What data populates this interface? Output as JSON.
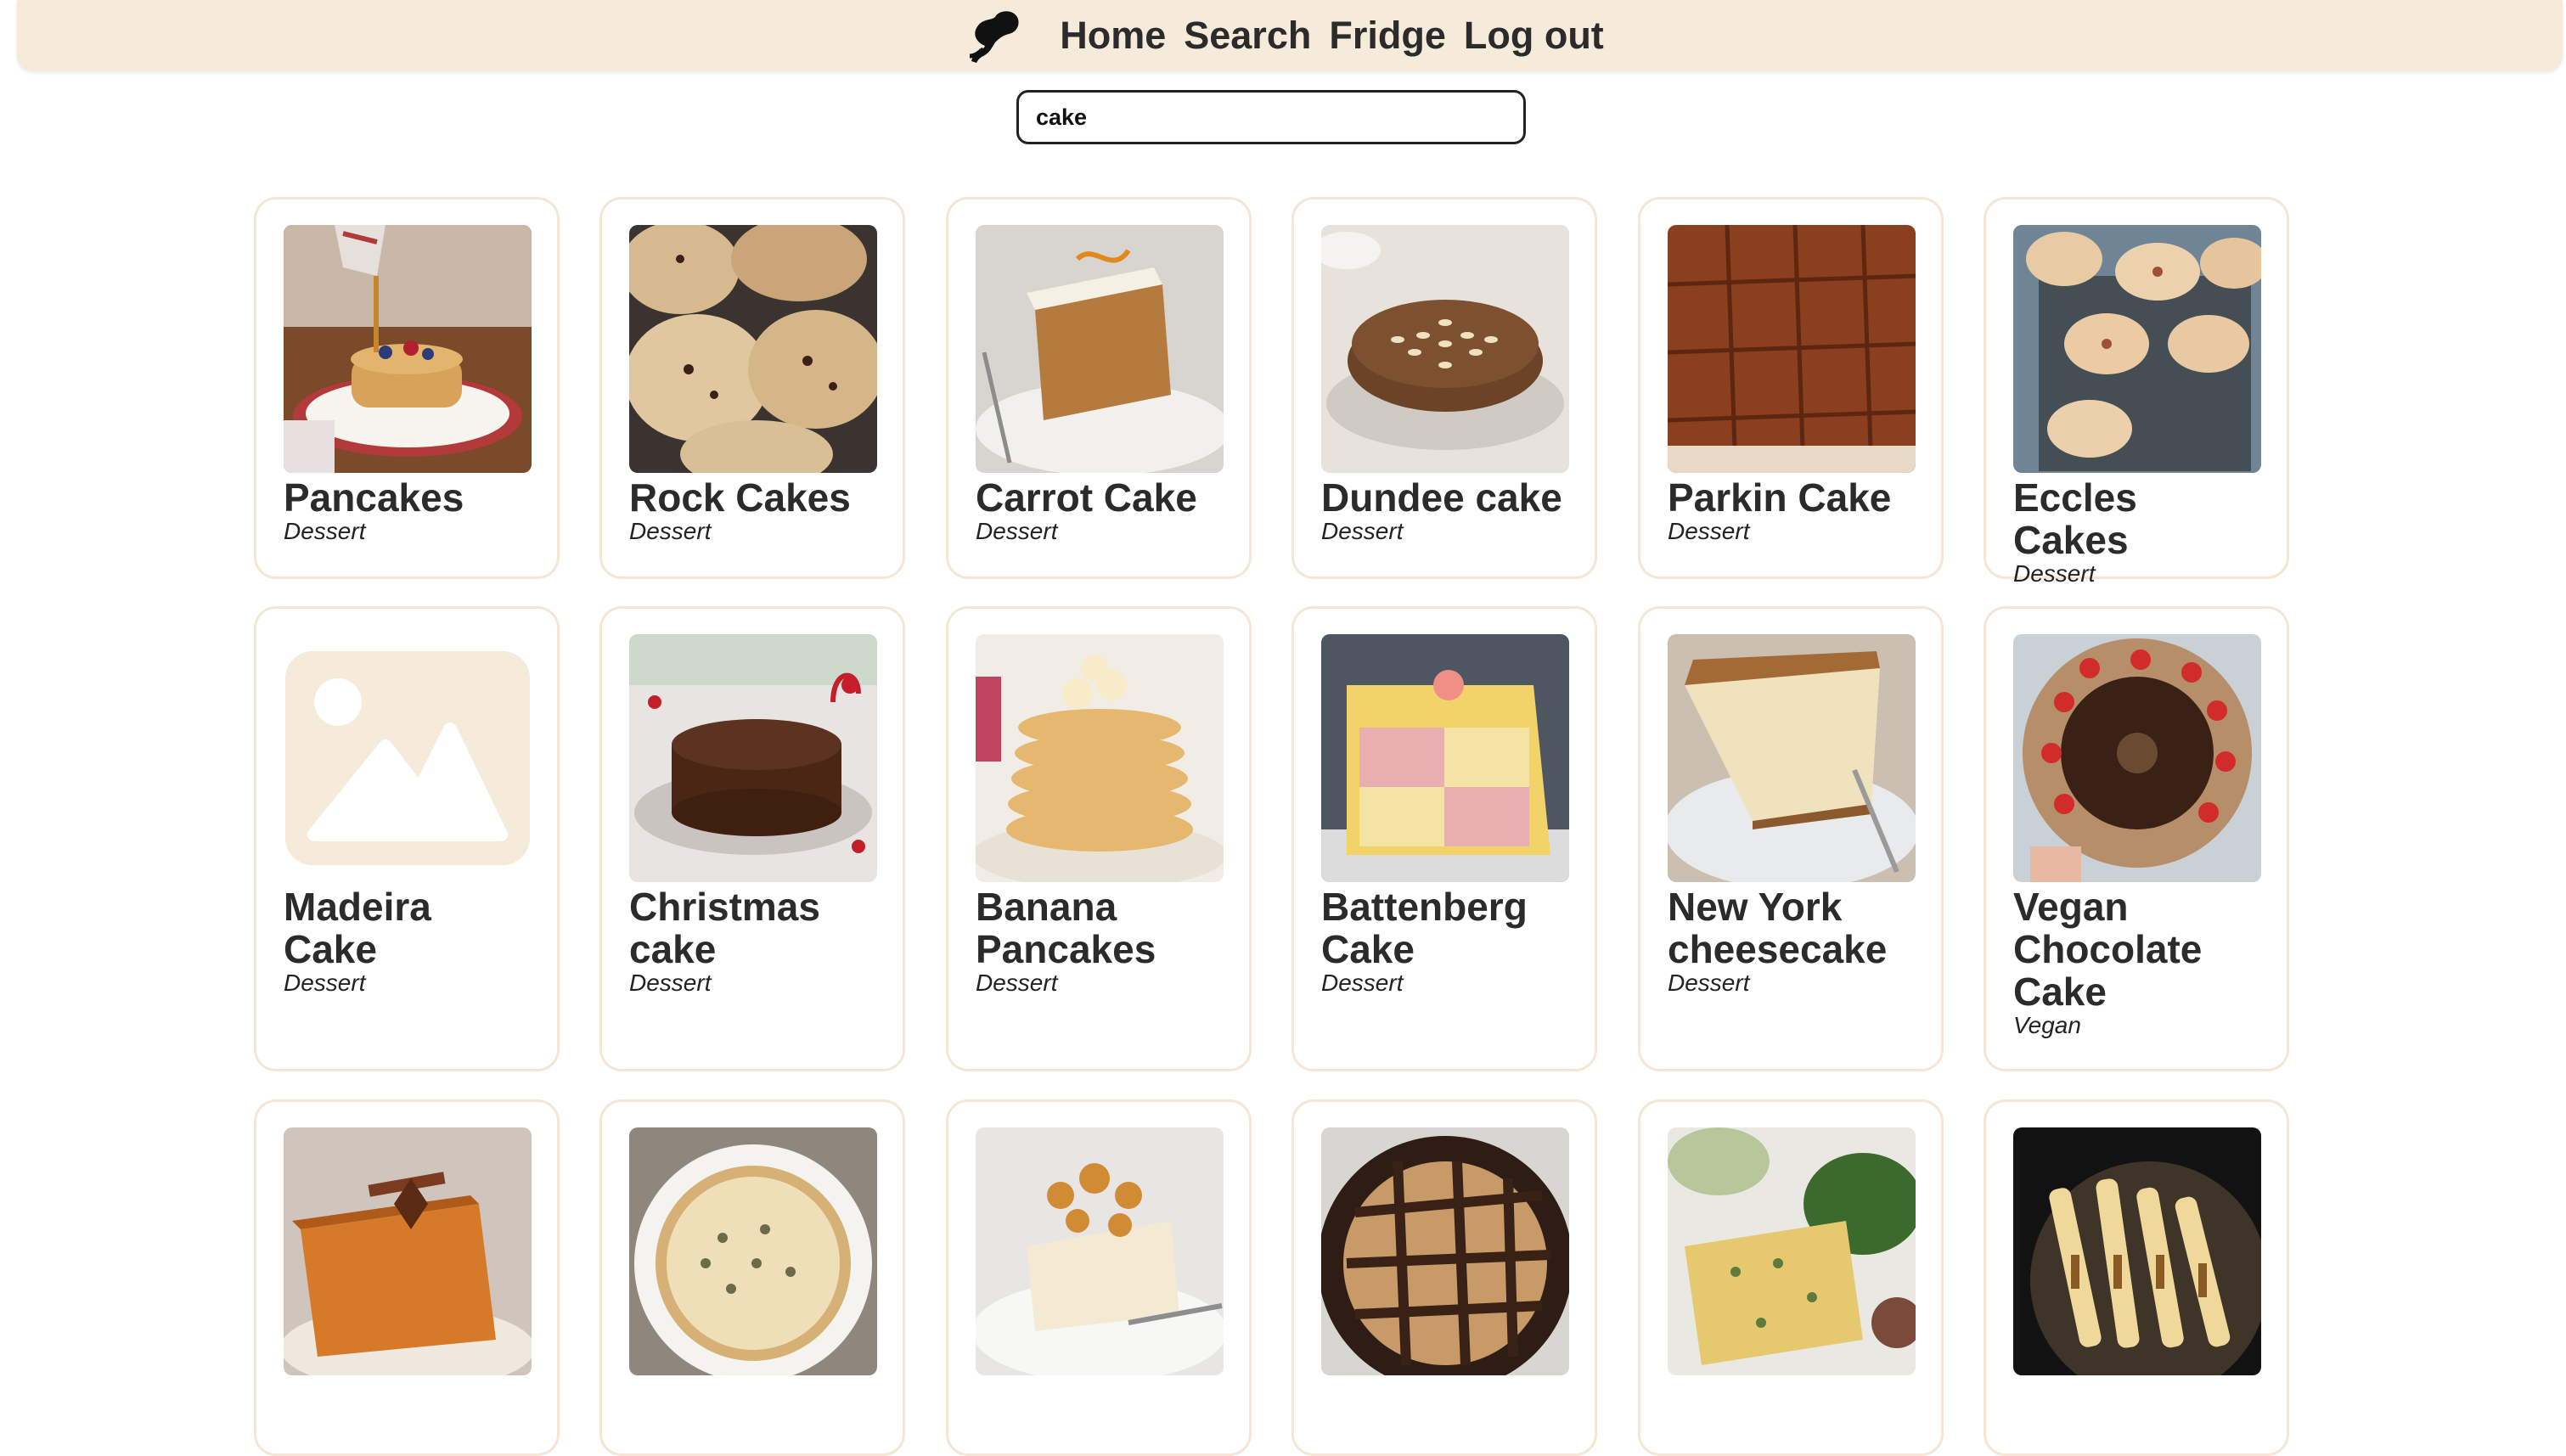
{
  "nav": {
    "logo_icon": "chef-hat-logo-icon",
    "links": [
      "Home",
      "Search",
      "Fridge",
      "Log out"
    ]
  },
  "search": {
    "value": "cake",
    "placeholder": ""
  },
  "colors": {
    "nav_bg": "#f6eadb",
    "card_border": "#f5e6d5",
    "placeholder_bg": "#f6eadb"
  },
  "recipes": [
    {
      "title": "Pancakes",
      "category": "Dessert",
      "image": "pancakes-photo"
    },
    {
      "title": "Rock Cakes",
      "category": "Dessert",
      "image": "rock-cakes-photo"
    },
    {
      "title": "Carrot Cake",
      "category": "Dessert",
      "image": "carrot-cake-photo"
    },
    {
      "title": "Dundee cake",
      "category": "Dessert",
      "image": "dundee-cake-photo"
    },
    {
      "title": "Parkin Cake",
      "category": "Dessert",
      "image": "parkin-cake-photo"
    },
    {
      "title": "Eccles Cakes",
      "category": "Dessert",
      "image": "eccles-cakes-photo"
    },
    {
      "title": "Madeira Cake",
      "category": "Dessert",
      "image": "image-placeholder-icon"
    },
    {
      "title": "Christmas cake",
      "category": "Dessert",
      "image": "christmas-cake-photo"
    },
    {
      "title": "Banana Pancakes",
      "category": "Dessert",
      "image": "banana-pancakes-photo"
    },
    {
      "title": "Battenberg Cake",
      "category": "Dessert",
      "image": "battenberg-cake-photo"
    },
    {
      "title": "New York cheesecake",
      "category": "Dessert",
      "image": "cheesecake-photo"
    },
    {
      "title": "Vegan Chocolate Cake",
      "category": "Vegan",
      "image": "vegan-chocolate-cake-photo"
    },
    {
      "title": "",
      "category": "",
      "image": "spiced-cake-photo"
    },
    {
      "title": "",
      "category": "",
      "image": "quiche-photo"
    },
    {
      "title": "",
      "category": "",
      "image": "caramel-cheesecake-photo"
    },
    {
      "title": "",
      "category": "",
      "image": "chocolate-tart-photo"
    },
    {
      "title": "",
      "category": "",
      "image": "frittata-photo"
    },
    {
      "title": "",
      "category": "",
      "image": "fried-pastry-photo"
    }
  ]
}
